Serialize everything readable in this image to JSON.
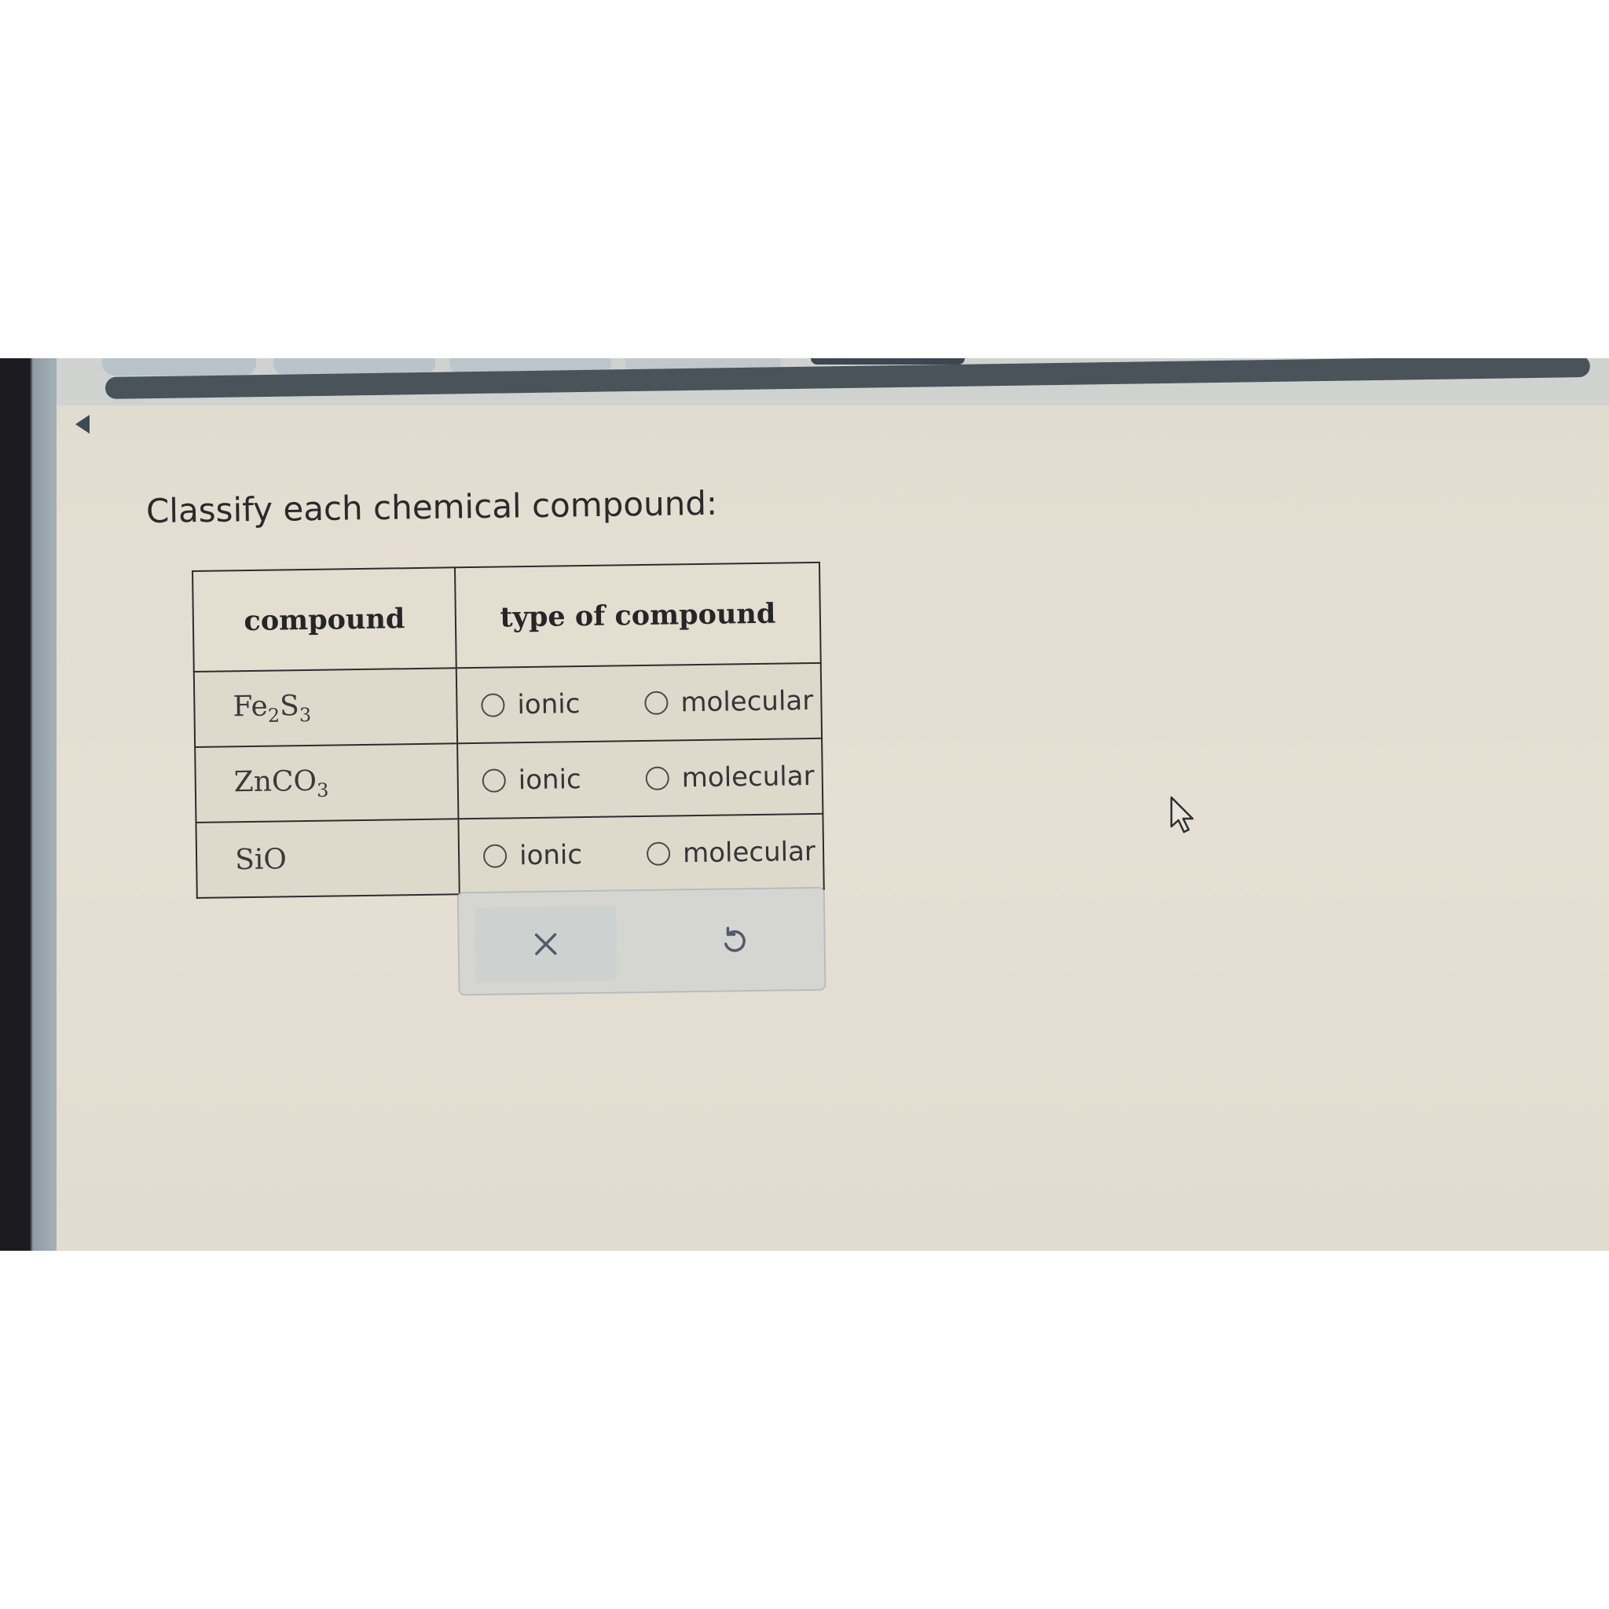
{
  "question": {
    "prompt": "Classify each chemical compound:"
  },
  "table": {
    "headers": {
      "compound": "compound",
      "type": "type of compound"
    },
    "rows": [
      {
        "element1": "Fe",
        "sub1": "2",
        "element2": "S",
        "sub2": "3",
        "options": {
          "ionic": "ionic",
          "molecular": "molecular"
        }
      },
      {
        "element1": "Zn",
        "sub1": "",
        "element2": "CO",
        "sub2": "3",
        "options": {
          "ionic": "ionic",
          "molecular": "molecular"
        }
      },
      {
        "element1": "SiO",
        "sub1": "",
        "element2": "",
        "sub2": "",
        "options": {
          "ionic": "ionic",
          "molecular": "molecular"
        }
      }
    ]
  },
  "actions": {
    "clear_icon": "x-icon",
    "reset_icon": "undo-icon"
  },
  "colors": {
    "page_background": "#e3decf",
    "progress_bar": "#4a525a",
    "table_border": "#2d2d30"
  },
  "icons": {
    "back": "back-arrow-icon",
    "cursor": "mouse-pointer-icon"
  }
}
